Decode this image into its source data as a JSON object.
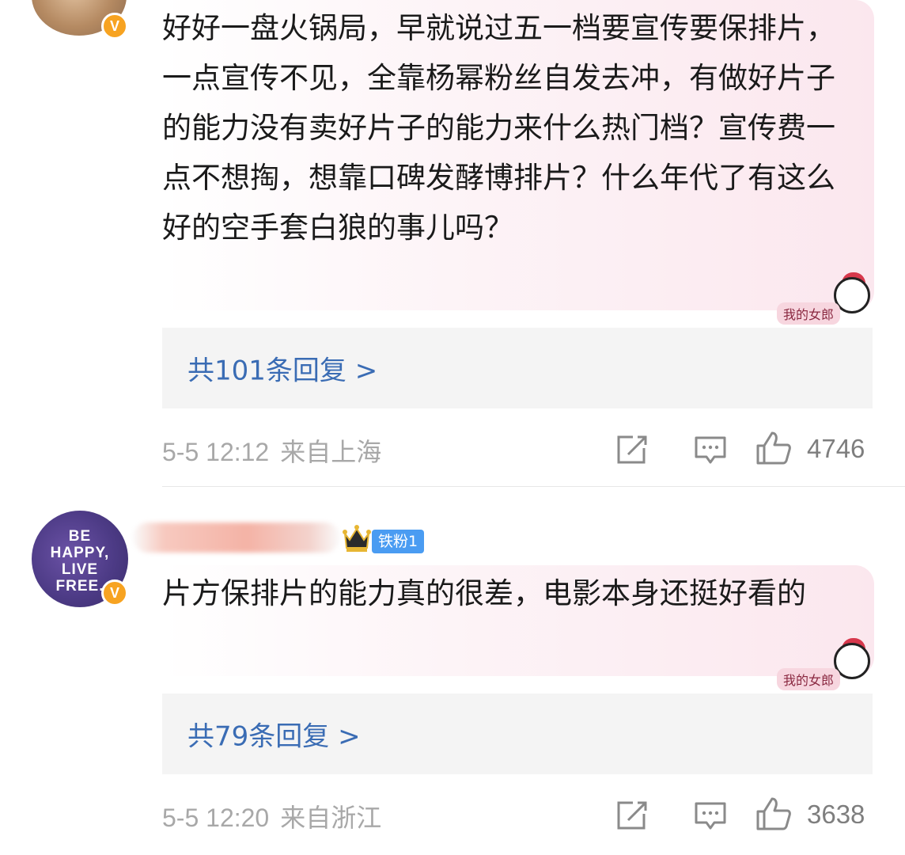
{
  "comments": [
    {
      "text": "好好一盘火锅局，早就说过五一档要宣传要保排片，一点宣传不见，全靠杨幂粉丝自发去冲，有做好片子的能力没有卖好片子的能力来什么热门档？宣传费一点不想掏，想靠口碑发酵博排片？什么年代了有这么好的空手套白狼的事儿吗？",
      "sticker_label": "我的女郎",
      "replies_label": "共101条回复 >",
      "date": "5-5 12:12",
      "location": "来自上海",
      "likes": "4746",
      "verified_badge": "V"
    },
    {
      "avatar_text": "BE HAPPY, LIVE FREE.",
      "fan_badge": "铁粉1",
      "text": "片方保排片的能力真的很差，电影本身还挺好看的",
      "sticker_label": "我的女郎",
      "replies_label": "共79条回复 >",
      "date": "5-5 12:20",
      "location": "来自浙江",
      "likes": "3638",
      "verified_badge": "V"
    }
  ],
  "colors": {
    "link_blue": "#3a6cb4",
    "meta_gray": "#a8a8a8",
    "badge_orange": "#f7a321",
    "fan_badge_blue": "#4a9cf2"
  },
  "icons": [
    "repost-icon",
    "comment-icon",
    "like-icon",
    "crown-icon",
    "verified-icon"
  ]
}
